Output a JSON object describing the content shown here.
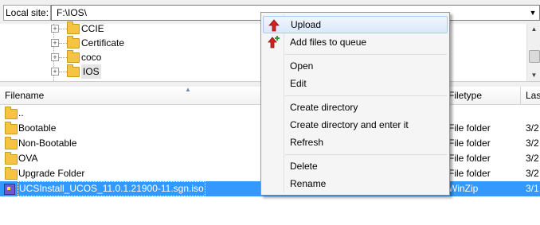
{
  "local_site": {
    "label": "Local site:",
    "path": "F:\\IOS\\"
  },
  "tree": {
    "items": [
      {
        "label": "CCIE"
      },
      {
        "label": "Certificate"
      },
      {
        "label": "coco"
      },
      {
        "label": "IOS"
      }
    ]
  },
  "list": {
    "columns": {
      "filename": "Filename",
      "filetype": "Filetype",
      "last": "Las"
    },
    "rows": [
      {
        "name": "..",
        "type": "",
        "date": ""
      },
      {
        "name": "Bootable",
        "type": "File folder",
        "date": "3/2"
      },
      {
        "name": "Non-Bootable",
        "type": "File folder",
        "date": "3/2"
      },
      {
        "name": "OVA",
        "type": "File folder",
        "date": "3/2"
      },
      {
        "name": "Upgrade Folder",
        "type": "File folder",
        "date": "3/2"
      },
      {
        "name": "UCSInstall_UCOS_11.0.1.21900-11.sgn.iso",
        "type": "WinZip",
        "date": "3/1"
      }
    ]
  },
  "context_menu": {
    "items": [
      {
        "label": "Upload",
        "icon": "upload-arrow-icon"
      },
      {
        "label": "Add files to queue",
        "icon": "add-to-queue-icon"
      },
      {
        "label": "Open"
      },
      {
        "label": "Edit"
      },
      {
        "label": "Create directory"
      },
      {
        "label": "Create directory and enter it"
      },
      {
        "label": "Refresh"
      },
      {
        "label": "Delete"
      },
      {
        "label": "Rename"
      }
    ]
  },
  "colors": {
    "selection": "#3399ff",
    "menu_hover": "#dbe9fb",
    "upload_arrow": "#d32020",
    "queue_plus": "#2e9e2e"
  }
}
